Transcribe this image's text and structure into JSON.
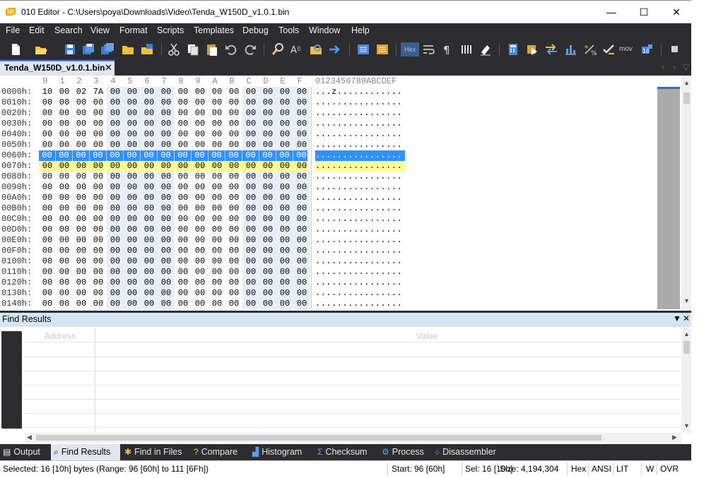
{
  "window": {
    "title": "010 Editor - C:\\Users\\poya\\Downloads\\Video\\Tenda_W150D_v1.0.1.bin",
    "minimize": "—",
    "maximize": "☐",
    "close": "✕"
  },
  "menu": [
    "File",
    "Edit",
    "Search",
    "View",
    "Format",
    "Scripts",
    "Templates",
    "Debug",
    "Tools",
    "Window",
    "Help"
  ],
  "toolbar": {
    "icons": [
      "new-file-icon",
      "open-file-icon",
      "save-icon",
      "save-as-icon",
      "save-all-icon",
      "open-folder-icon",
      "open-project-icon",
      "cut-icon",
      "copy-icon",
      "paste-icon",
      "undo-icon",
      "redo-icon",
      "find-icon",
      "replace-icon",
      "find-in-files-icon",
      "goto-icon",
      "compare-icon",
      "compare2-icon",
      "hex-mode-icon",
      "word-wrap-icon",
      "show-whitespace-icon",
      "columns-icon",
      "highlight-icon",
      "calculator-icon",
      "run-template-icon",
      "swap-icon",
      "histogram-icon",
      "base-converter-icon",
      "checksum-icon",
      "mov-icon",
      "disassembler-icon",
      "stop-icon"
    ],
    "hex_label": "Hex",
    "mov_label": "mov"
  },
  "tab": {
    "label": "Tenda_W150D_v1.0.1.bin",
    "close": "✕"
  },
  "hex": {
    "columns": [
      "0",
      "1",
      "2",
      "3",
      "4",
      "5",
      "6",
      "7",
      "8",
      "9",
      "A",
      "B",
      "C",
      "D",
      "E",
      "F"
    ],
    "ascii_header": "0123456789ABCDEF",
    "rows": [
      {
        "addr": "0000h:",
        "bytes": [
          "10",
          "00",
          "02",
          "7A",
          "00",
          "00",
          "00",
          "00",
          "00",
          "00",
          "00",
          "00",
          "00",
          "00",
          "00",
          "00"
        ],
        "ascii": "...z............",
        "state": "normal"
      },
      {
        "addr": "0010h:",
        "bytes": [
          "00",
          "00",
          "00",
          "00",
          "00",
          "00",
          "00",
          "00",
          "00",
          "00",
          "00",
          "00",
          "00",
          "00",
          "00",
          "00"
        ],
        "ascii": "................",
        "state": "normal"
      },
      {
        "addr": "0020h:",
        "bytes": [
          "00",
          "00",
          "00",
          "00",
          "00",
          "00",
          "00",
          "00",
          "00",
          "00",
          "00",
          "00",
          "00",
          "00",
          "00",
          "00"
        ],
        "ascii": "................",
        "state": "normal"
      },
      {
        "addr": "0030h:",
        "bytes": [
          "00",
          "00",
          "00",
          "00",
          "00",
          "00",
          "00",
          "00",
          "00",
          "00",
          "00",
          "00",
          "00",
          "00",
          "00",
          "00"
        ],
        "ascii": "................",
        "state": "normal"
      },
      {
        "addr": "0040h:",
        "bytes": [
          "00",
          "00",
          "00",
          "00",
          "00",
          "00",
          "00",
          "00",
          "00",
          "00",
          "00",
          "00",
          "00",
          "00",
          "00",
          "00"
        ],
        "ascii": "................",
        "state": "normal"
      },
      {
        "addr": "0050h:",
        "bytes": [
          "00",
          "00",
          "00",
          "00",
          "00",
          "00",
          "00",
          "00",
          "00",
          "00",
          "00",
          "00",
          "00",
          "00",
          "00",
          "00"
        ],
        "ascii": "................",
        "state": "normal"
      },
      {
        "addr": "0060h:",
        "bytes": [
          "00",
          "00",
          "00",
          "00",
          "00",
          "00",
          "00",
          "00",
          "00",
          "00",
          "00",
          "00",
          "00",
          "00",
          "00",
          "00"
        ],
        "ascii": "................",
        "state": "selected"
      },
      {
        "addr": "0070h:",
        "bytes": [
          "00",
          "00",
          "00",
          "00",
          "00",
          "00",
          "00",
          "00",
          "00",
          "00",
          "00",
          "00",
          "00",
          "00",
          "00",
          "00"
        ],
        "ascii": "................",
        "state": "cursor"
      },
      {
        "addr": "0080h:",
        "bytes": [
          "00",
          "00",
          "00",
          "00",
          "00",
          "00",
          "00",
          "00",
          "00",
          "00",
          "00",
          "00",
          "00",
          "00",
          "00",
          "00"
        ],
        "ascii": "................",
        "state": "normal"
      },
      {
        "addr": "0090h:",
        "bytes": [
          "00",
          "00",
          "00",
          "00",
          "00",
          "00",
          "00",
          "00",
          "00",
          "00",
          "00",
          "00",
          "00",
          "00",
          "00",
          "00"
        ],
        "ascii": "................",
        "state": "normal"
      },
      {
        "addr": "00A0h:",
        "bytes": [
          "00",
          "00",
          "00",
          "00",
          "00",
          "00",
          "00",
          "00",
          "00",
          "00",
          "00",
          "00",
          "00",
          "00",
          "00",
          "00"
        ],
        "ascii": "................",
        "state": "normal"
      },
      {
        "addr": "00B0h:",
        "bytes": [
          "00",
          "00",
          "00",
          "00",
          "00",
          "00",
          "00",
          "00",
          "00",
          "00",
          "00",
          "00",
          "00",
          "00",
          "00",
          "00"
        ],
        "ascii": "................",
        "state": "normal"
      },
      {
        "addr": "00C0h:",
        "bytes": [
          "00",
          "00",
          "00",
          "00",
          "00",
          "00",
          "00",
          "00",
          "00",
          "00",
          "00",
          "00",
          "00",
          "00",
          "00",
          "00"
        ],
        "ascii": "................",
        "state": "normal"
      },
      {
        "addr": "00D0h:",
        "bytes": [
          "00",
          "00",
          "00",
          "00",
          "00",
          "00",
          "00",
          "00",
          "00",
          "00",
          "00",
          "00",
          "00",
          "00",
          "00",
          "00"
        ],
        "ascii": "................",
        "state": "normal"
      },
      {
        "addr": "00E0h:",
        "bytes": [
          "00",
          "00",
          "00",
          "00",
          "00",
          "00",
          "00",
          "00",
          "00",
          "00",
          "00",
          "00",
          "00",
          "00",
          "00",
          "00"
        ],
        "ascii": "................",
        "state": "normal"
      },
      {
        "addr": "00F0h:",
        "bytes": [
          "00",
          "00",
          "00",
          "00",
          "00",
          "00",
          "00",
          "00",
          "00",
          "00",
          "00",
          "00",
          "00",
          "00",
          "00",
          "00"
        ],
        "ascii": "................",
        "state": "normal"
      },
      {
        "addr": "0100h:",
        "bytes": [
          "00",
          "00",
          "00",
          "00",
          "00",
          "00",
          "00",
          "00",
          "00",
          "00",
          "00",
          "00",
          "00",
          "00",
          "00",
          "00"
        ],
        "ascii": "................",
        "state": "normal"
      },
      {
        "addr": "0110h:",
        "bytes": [
          "00",
          "00",
          "00",
          "00",
          "00",
          "00",
          "00",
          "00",
          "00",
          "00",
          "00",
          "00",
          "00",
          "00",
          "00",
          "00"
        ],
        "ascii": "................",
        "state": "normal"
      },
      {
        "addr": "0120h:",
        "bytes": [
          "00",
          "00",
          "00",
          "00",
          "00",
          "00",
          "00",
          "00",
          "00",
          "00",
          "00",
          "00",
          "00",
          "00",
          "00",
          "00"
        ],
        "ascii": "................",
        "state": "normal"
      },
      {
        "addr": "0130h:",
        "bytes": [
          "00",
          "00",
          "00",
          "00",
          "00",
          "00",
          "00",
          "00",
          "00",
          "00",
          "00",
          "00",
          "00",
          "00",
          "00",
          "00"
        ],
        "ascii": "................",
        "state": "normal"
      },
      {
        "addr": "0140h:",
        "bytes": [
          "00",
          "00",
          "00",
          "00",
          "00",
          "00",
          "00",
          "00",
          "00",
          "00",
          "00",
          "00",
          "00",
          "00",
          "00",
          "00"
        ],
        "ascii": "................",
        "state": "normal"
      }
    ]
  },
  "find_results": {
    "title": "Find Results",
    "col_address": "Address",
    "col_value": "Value",
    "dropdown": "▼",
    "close": "✕"
  },
  "bottom_tabs": [
    {
      "label": "Output",
      "icon": "output-icon",
      "active": false
    },
    {
      "label": "Find Results",
      "icon": "find-results-icon",
      "active": true
    },
    {
      "label": "Find in Files",
      "icon": "find-in-files-icon",
      "active": false
    },
    {
      "label": "Compare",
      "icon": "compare-icon",
      "active": false
    },
    {
      "label": "Histogram",
      "icon": "histogram-icon",
      "active": false
    },
    {
      "label": "Checksum",
      "icon": "checksum-icon",
      "active": false
    },
    {
      "label": "Process",
      "icon": "process-icon",
      "active": false
    },
    {
      "label": "Disassembler",
      "icon": "disassembler-icon",
      "active": false
    }
  ],
  "status": {
    "selected": "Selected: 16 [10h] bytes (Range: 96 [60h] to 111 [6Fh])",
    "start": "Start: 96 [60h]",
    "sel": "Sel: 16 [10h]",
    "size": "Size: 4,194,304",
    "mode": "Hex",
    "encoding": "ANSI",
    "endian": "LIT",
    "write": "W",
    "insert": "OVR"
  },
  "colors": {
    "dark": "#2d2d30",
    "selection": "#3390ff",
    "cursor_row": "#fffa9a",
    "panel_header": "#d5e4f3"
  }
}
